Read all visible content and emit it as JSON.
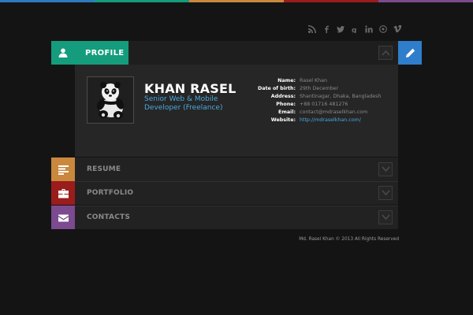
{
  "top_colors": [
    "#2d7bbf",
    "#159c7c",
    "#c9883d",
    "#9b1c1c",
    "#7b4a8f"
  ],
  "social_icons": [
    "rss-icon",
    "facebook-icon",
    "twitter-icon",
    "google-plus-icon",
    "linkedin-icon",
    "dribbble-icon",
    "vimeo-icon"
  ],
  "profile": {
    "tab_label": "PROFILE",
    "name": "KHAN RASEL",
    "role": "Senior Web & Mobile Developer (Freelance)",
    "info_rows": [
      {
        "label": "Name:",
        "value": "Rasel Khan"
      },
      {
        "label": "Date of birth:",
        "value": "29th December"
      },
      {
        "label": "Address:",
        "value": "Shantinagar, Dhaka, Bangladesh"
      },
      {
        "label": "Phone:",
        "value": "+88 01716 481276"
      },
      {
        "label": "Email:",
        "value": "contact@mdraselkhan.com"
      },
      {
        "label": "Website:",
        "value": "http://mdraselkhan.com/"
      }
    ]
  },
  "sections": [
    {
      "label": "RESUME",
      "color": "#c9883d",
      "icon": "resume-icon"
    },
    {
      "label": "PORTFOLIO",
      "color": "#9b1c1c",
      "icon": "briefcase-icon"
    },
    {
      "label": "CONTACTS",
      "color": "#7b4a8f",
      "icon": "envelope-icon"
    }
  ],
  "accent": {
    "profile": "#159c7c",
    "edit": "#2f7ecb",
    "link": "#49a9e0"
  },
  "footer": "Md. Rasel Khan © 2013 All Rights Reserved"
}
